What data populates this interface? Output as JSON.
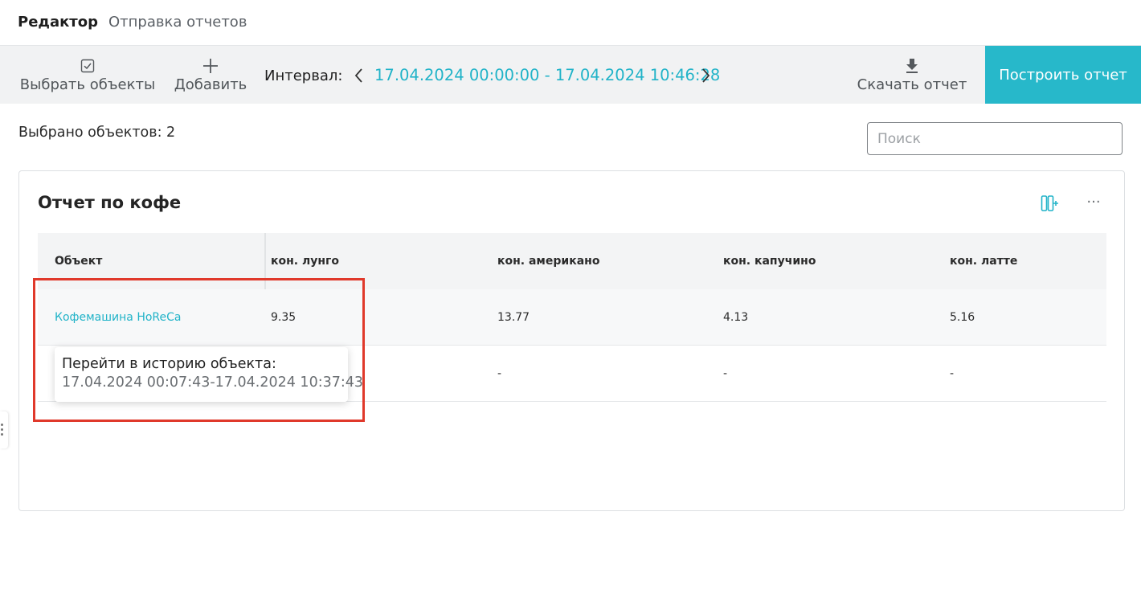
{
  "tabs": [
    {
      "label": "Редактор",
      "active": true
    },
    {
      "label": "Отправка отчетов",
      "active": false
    }
  ],
  "toolbar": {
    "select_objects": "Выбрать объекты",
    "add": "Добавить",
    "interval_label": "Интервал:",
    "interval_value": "17.04.2024 00:00:00 - 17.04.2024 10:46:28",
    "download": "Скачать отчет",
    "build": "Построить отчет"
  },
  "selected_count": "Выбрано объектов: 2",
  "search": {
    "placeholder": "Поиск",
    "value": ""
  },
  "report": {
    "title": "Отчет по кофе",
    "columns": [
      "Объект",
      "кон. лунго",
      "кон. американо",
      "кон. капучино",
      "кон. латте"
    ],
    "rows": [
      [
        "Кофемашина HoReCa",
        "9.35",
        "13.77",
        "4.13",
        "5.16"
      ],
      [
        "",
        "",
        "-",
        "-",
        "-"
      ]
    ]
  },
  "tooltip": {
    "line1": "Перейти в историю объекта:",
    "line2": "17.04.2024 00:07:43-17.04.2024 10:37:43"
  },
  "colors": {
    "accent": "#27b8ca",
    "link": "#21b3c8",
    "highlight_box": "#e0392b",
    "toolbar_bg": "#f1f2f3"
  },
  "icons": {
    "select_objects": "checkbox-icon",
    "add": "plus-icon",
    "prev": "chevron-left-icon",
    "next": "chevron-right-icon",
    "download": "download-icon",
    "columns": "column-settings-icon",
    "more": "more-horizontal-icon"
  }
}
